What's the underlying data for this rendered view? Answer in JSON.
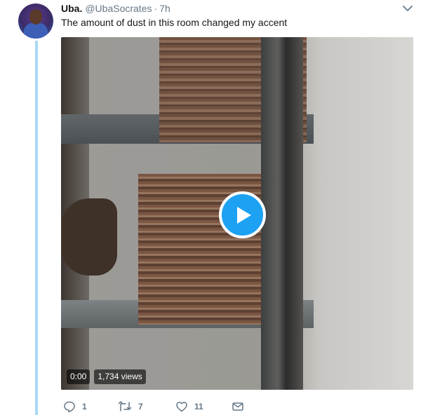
{
  "tweet": {
    "author_name": "Uba.",
    "author_handle": "@UbaSocrates",
    "separator": "·",
    "time": "7h",
    "text": "The amount of dust in this room changed my accent"
  },
  "media": {
    "type": "video",
    "duration": "0:00",
    "views": "1,734 views"
  },
  "actions": {
    "replies": "1",
    "retweets": "7",
    "likes": "11"
  },
  "icons": {
    "menu": "chevron-down-icon",
    "play": "play-icon",
    "reply": "reply-icon",
    "retweet": "retweet-icon",
    "like": "heart-icon",
    "dm": "envelope-icon"
  },
  "colors": {
    "accent": "#1da1f2",
    "thread_line": "#a7d9f6",
    "secondary_text": "#657786"
  }
}
